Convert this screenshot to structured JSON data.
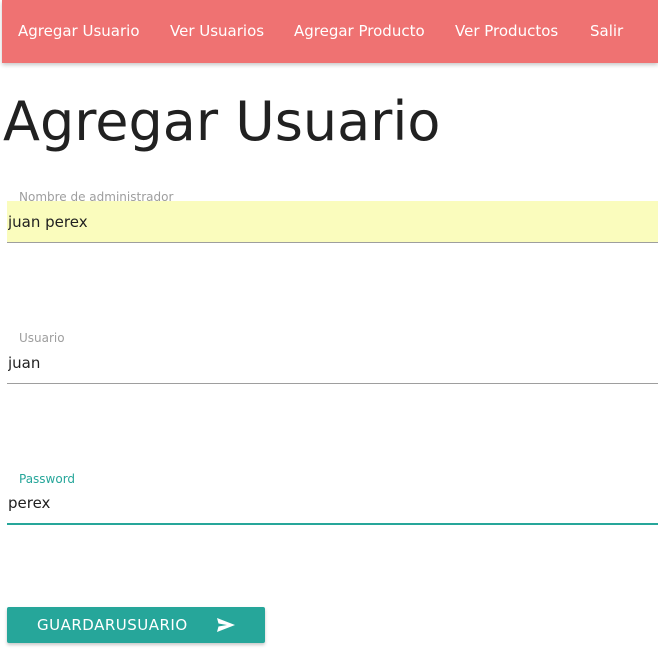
{
  "navbar": {
    "items": [
      {
        "label": "Agregar Usuario"
      },
      {
        "label": "Ver Usuarios"
      },
      {
        "label": "Agregar Producto"
      },
      {
        "label": "Ver Productos"
      },
      {
        "label": "Salir"
      }
    ],
    "background_color": "#ef7272"
  },
  "page": {
    "title": "Agregar Usuario"
  },
  "form": {
    "fields": [
      {
        "label": "Nombre de administrador",
        "value": "juan perex",
        "autofilled": true
      },
      {
        "label": "Usuario",
        "value": "juan"
      },
      {
        "label": "Password",
        "value": "perex",
        "focused": true
      }
    ],
    "submit": {
      "label": "GUARDARUSUARIO",
      "icon": "send-icon"
    },
    "accent_color": "#26a69a",
    "autofill_color": "#fafcbd"
  }
}
